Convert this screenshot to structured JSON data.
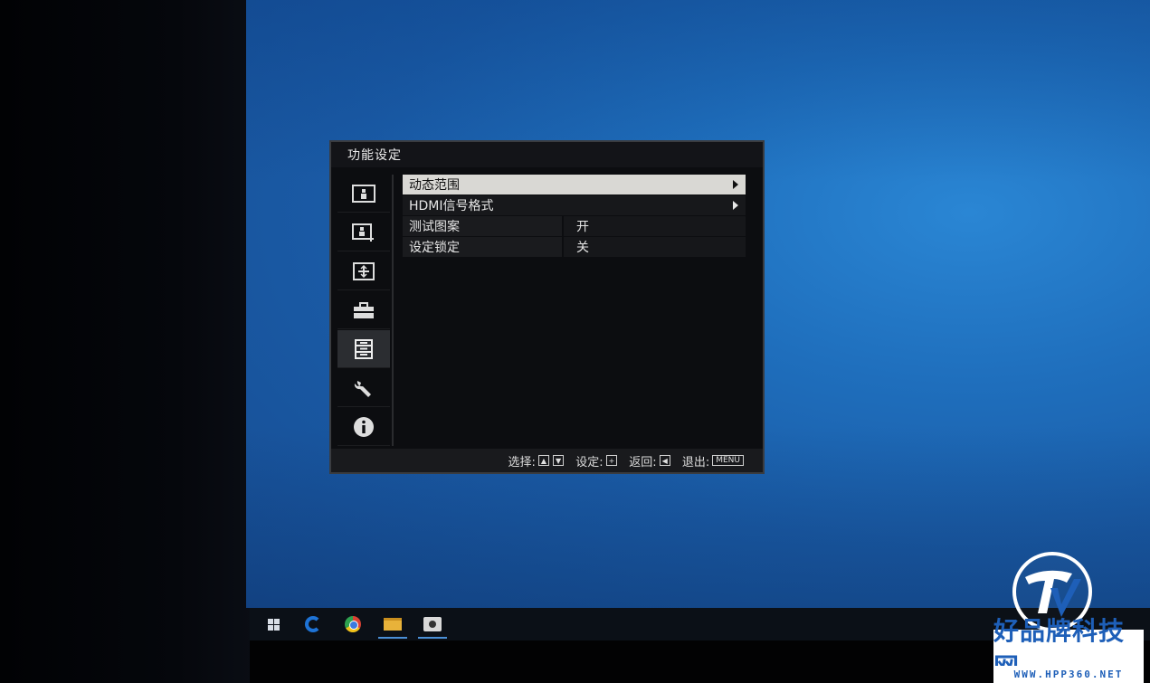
{
  "osd": {
    "title": "功能设定",
    "sidebar": [
      {
        "icon": "picture-icon"
      },
      {
        "icon": "picture-plus-icon"
      },
      {
        "icon": "screen-adjust-icon"
      },
      {
        "icon": "toolbox-icon"
      },
      {
        "icon": "function-list-icon",
        "selected": true
      },
      {
        "icon": "wrench-icon"
      },
      {
        "icon": "info-icon"
      }
    ],
    "rows": [
      {
        "label": "动态范围",
        "has_submenu": true,
        "selected": true
      },
      {
        "label": "HDMI信号格式",
        "has_submenu": true
      },
      {
        "label": "测试图案",
        "value": "开"
      },
      {
        "label": "设定锁定",
        "value": "关"
      }
    ],
    "footer": {
      "select_label": "选择:",
      "set_label": "设定:",
      "back_label": "返回:",
      "exit_label": "退出:",
      "menu_key": "MENU"
    }
  },
  "taskbar": {
    "icons": [
      "windows-start-icon",
      "edge-icon",
      "chrome-icon",
      "file-explorer-icon",
      "camera-app-icon"
    ]
  },
  "watermark": {
    "brand": "好品牌科技网",
    "url": "WWW.HPP360.NET"
  }
}
